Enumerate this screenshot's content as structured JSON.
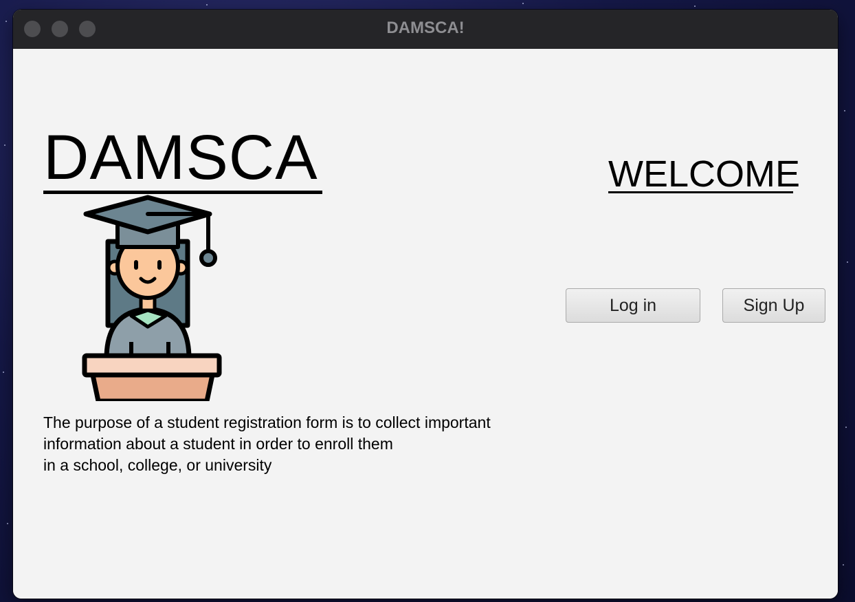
{
  "window": {
    "title": "DAMSCA!",
    "traffic_lights": [
      "close",
      "minimize",
      "zoom"
    ]
  },
  "brand": {
    "name": "DAMSCA"
  },
  "welcome": {
    "heading": "WELCOME"
  },
  "illustration": {
    "icon": "graduate-student-at-podium-icon"
  },
  "description": {
    "lines": [
      "The purpose of a student registration form is to collect important",
      "information about a student in order to enroll them",
      "in a school, college, or university"
    ]
  },
  "actions": {
    "login_label": "Log in",
    "signup_label": "Sign Up"
  },
  "colors": {
    "titlebar": "#252528",
    "window_bg": "#f3f3f3",
    "desktop_bg": "#151847"
  }
}
